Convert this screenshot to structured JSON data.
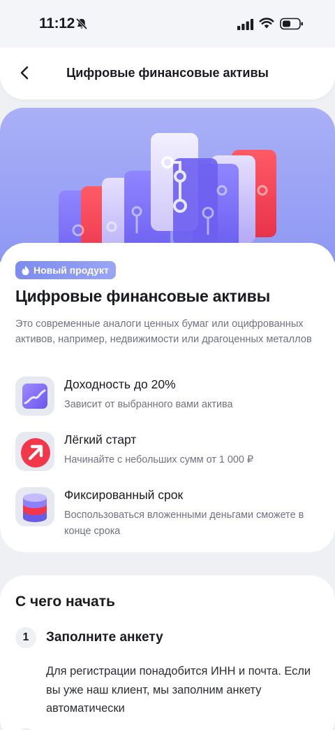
{
  "status_bar": {
    "time": "11:12",
    "icons": [
      "bell-off-icon",
      "signal-icon",
      "wifi-icon",
      "battery-icon"
    ]
  },
  "header": {
    "back_icon": "chevron-left-icon",
    "title": "Цифровые финансовые активы"
  },
  "hero": {
    "illustration": "stacked-asset-cards-illustration",
    "colors": {
      "background": "#9aa3f5",
      "accent_red": "#f0485a",
      "accent_purple": "#7c6cf5"
    }
  },
  "intro": {
    "badge_icon": "flame-icon",
    "badge": "Новый продукт",
    "title": "Цифровые финансовые активы",
    "description": "Это современные аналоги ценных бумаг или оцифрованных активов, например, недвижимости или драгоценных металлов",
    "features": [
      {
        "icon": "chart-wave-icon",
        "title": "Доходность до 20%",
        "subtitle": "Зависит от выбранного вами актива"
      },
      {
        "icon": "arrow-up-right-icon",
        "title": "Лёгкий старт",
        "subtitle": "Начинайте с небольших сумм от 1 000 ₽"
      },
      {
        "icon": "coin-stack-icon",
        "title": "Фиксированный срок",
        "subtitle": "Воспользоваться вложенными деньгами сможете в конце срока"
      }
    ]
  },
  "getting_started": {
    "title": "С чего начать",
    "steps": [
      {
        "number": "1",
        "title": "Заполните анкету",
        "description": "Для регистрации понадобится ИНН и почта. Если вы уже наш клиент, мы заполним анкету автоматически"
      }
    ]
  }
}
